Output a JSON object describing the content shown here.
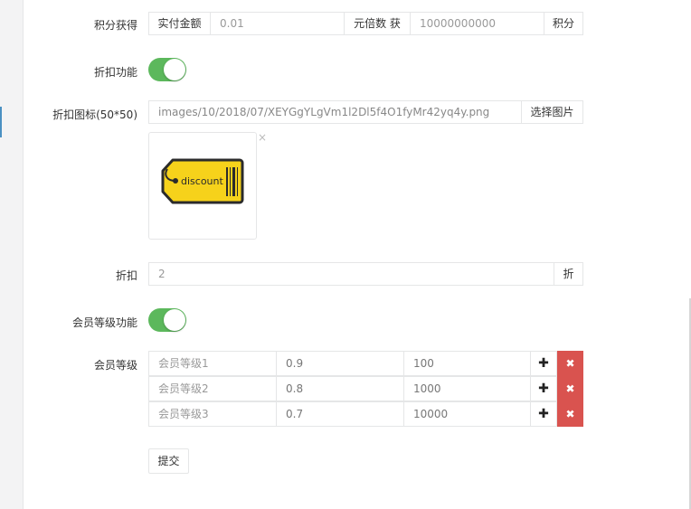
{
  "points": {
    "label": "积分获得",
    "amount_addon": "实付金额",
    "amount_value": "0.01",
    "multiple_addon": "元倍数 获",
    "multiple_value": "10000000000",
    "points_addon": "积分"
  },
  "discount_feature": {
    "label": "折扣功能",
    "enabled": true
  },
  "discount_icon": {
    "label": "折扣图标(50*50)",
    "path": "images/10/2018/07/XEYGgYLgVm1l2Dl5f4O1fyMr42yq4y.png",
    "choose_button": "选择图片",
    "remove_icon": "×",
    "tag_text": "discount",
    "tag_color": "#f6d21b"
  },
  "discount": {
    "label": "折扣",
    "value": "2",
    "suffix": "折"
  },
  "member_level_feature": {
    "label": "会员等级功能",
    "enabled": true
  },
  "member_levels": {
    "label": "会员等级",
    "rows": [
      {
        "name": "会员等级1",
        "discount": "0.9",
        "points": "100"
      },
      {
        "name": "会员等级2",
        "discount": "0.8",
        "points": "1000"
      },
      {
        "name": "会员等级3",
        "discount": "0.7",
        "points": "10000"
      }
    ],
    "add_symbol": "✚",
    "delete_symbol": "✖"
  },
  "submit_label": "提交",
  "colors": {
    "toggle_on": "#5cb85c",
    "danger": "#d9534f",
    "border": "#e5e6e7"
  }
}
